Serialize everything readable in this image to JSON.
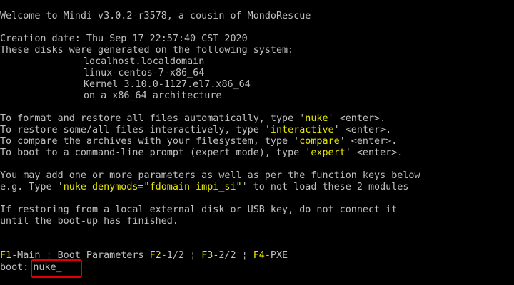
{
  "welcome": "Welcome to Mindi v3.0.2-r3578, a cousin of MondoRescue",
  "creation_date": "Creation date: Thu Sep 17 22:57:40 CST 2020",
  "system_intro": "These disks were generated on the following system:",
  "system_lines": [
    "localhost.localdomain",
    "linux-centos-7-x86_64",
    "Kernel 3.10.0-1127.el7.x86_64",
    "on a x86_64 architecture"
  ],
  "instructions": [
    {
      "pre": "To format and restore all files automatically, type '",
      "cmd": "nuke",
      "post": "' <enter>."
    },
    {
      "pre": "To restore some/all files interactively, type '",
      "cmd": "interactive",
      "post": "' <enter>."
    },
    {
      "pre": "To compare the archives with your filesystem, type '",
      "cmd": "compare",
      "post": "' <enter>."
    },
    {
      "pre": "To boot to a command-line prompt (expert mode), type '",
      "cmd": "expert",
      "post": "' <enter>."
    }
  ],
  "params": {
    "line1": "You may add one or more parameters as well as per the function keys below",
    "line2_pre": "e.g. Type '",
    "line2_cmd": "nuke denymods=\"fdomain impi_si\"",
    "line2_post": "' to not load these 2 modules"
  },
  "restore_note": [
    "If restoring from a local external disk or USB key, do not connect it",
    "until the boot-up has finished."
  ],
  "fkeys": [
    {
      "key": "F1",
      "label": "-Main"
    },
    {
      "key": "F2",
      "label": "-1/2"
    },
    {
      "key": "F3",
      "label": "-2/2"
    },
    {
      "key": "F4",
      "label": "-PXE"
    }
  ],
  "boot_params_label": "Boot Parameters",
  "separator": "¦",
  "prompt": {
    "label": "boot:",
    "value": "nuke_"
  },
  "colors": {
    "background": "#000000",
    "text": "#c0c0c0",
    "highlight": "#e6e600",
    "annotation": "#e00000"
  }
}
